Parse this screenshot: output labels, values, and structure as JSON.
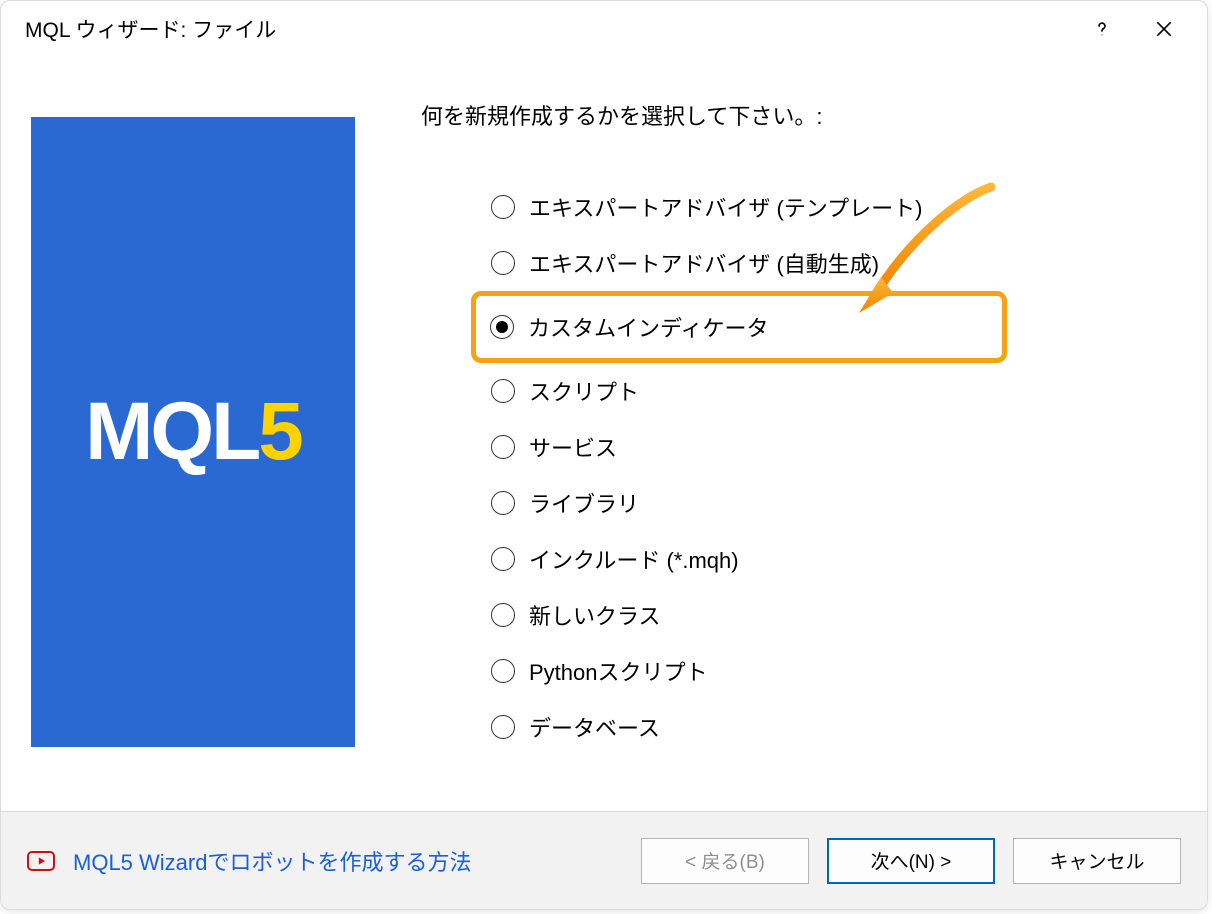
{
  "titlebar": {
    "title": "MQL ウィザード: ファイル"
  },
  "banner": {
    "logo_left": "MQL",
    "logo_right": "5"
  },
  "prompt": "何を新規作成するかを選択して下さい。:",
  "options": [
    {
      "label": "エキスパートアドバイザ (テンプレート)",
      "selected": false,
      "highlight": false
    },
    {
      "label": "エキスパートアドバイザ (自動生成)",
      "selected": false,
      "highlight": false
    },
    {
      "label": "カスタムインディケータ",
      "selected": true,
      "highlight": true
    },
    {
      "label": "スクリプト",
      "selected": false,
      "highlight": false
    },
    {
      "label": "サービス",
      "selected": false,
      "highlight": false
    },
    {
      "label": "ライブラリ",
      "selected": false,
      "highlight": false
    },
    {
      "label": "インクルード (*.mqh)",
      "selected": false,
      "highlight": false
    },
    {
      "label": "新しいクラス",
      "selected": false,
      "highlight": false
    },
    {
      "label": "Pythonスクリプト",
      "selected": false,
      "highlight": false
    },
    {
      "label": "データベース",
      "selected": false,
      "highlight": false
    }
  ],
  "footer": {
    "help_text": "MQL5 Wizardでロボットを作成する方法",
    "back": "< 戻る(B)",
    "next": "次へ(N) >",
    "cancel": "キャンセル"
  }
}
